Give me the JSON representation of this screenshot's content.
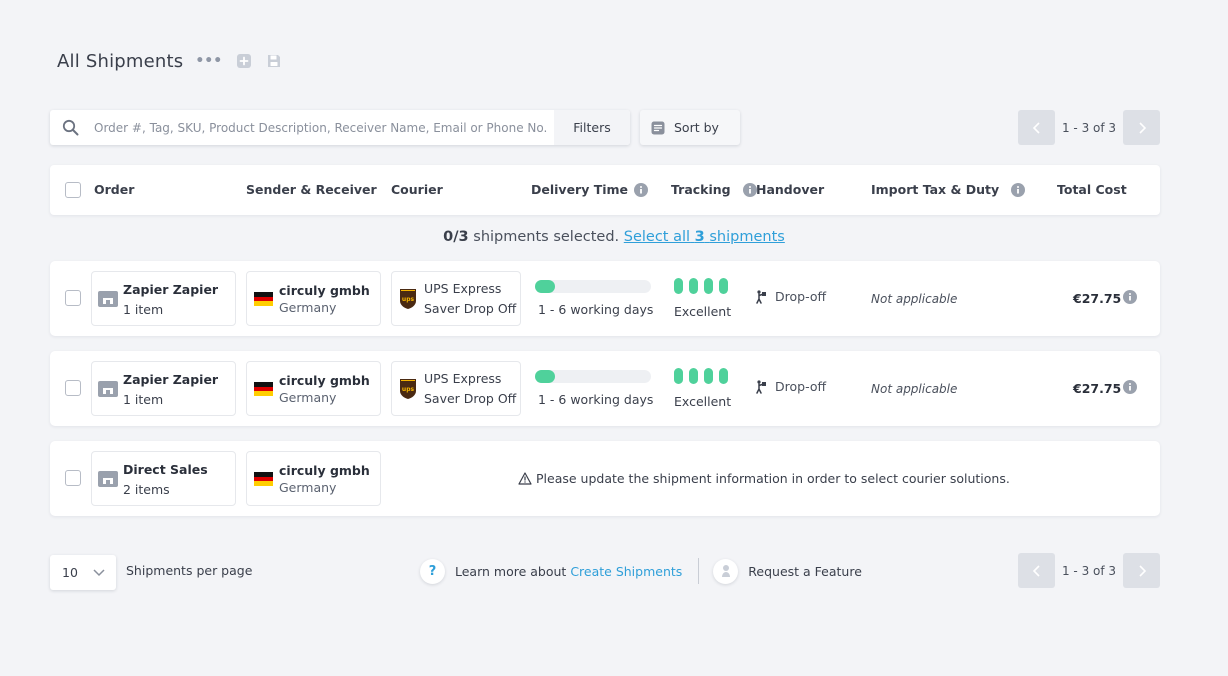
{
  "header": {
    "title": "All Shipments",
    "more_icon": "ellipsis-icon",
    "add_icon": "plus-square-icon",
    "save_icon": "floppy-disk-icon"
  },
  "toolbar": {
    "search_placeholder": "Order #, Tag, SKU, Product Description, Receiver Name, Email or Phone No.",
    "filters_label": "Filters",
    "sort_label": "Sort by",
    "pagination_text": "1 - 3 of 3"
  },
  "columns": [
    "Order",
    "Sender & Receiver",
    "Courier",
    "Delivery Time",
    "Tracking",
    "Handover",
    "Import Tax & Duty",
    "Total Cost"
  ],
  "selection": {
    "count": "0/3",
    "text": "shipments selected.",
    "link_prefix": "Select all",
    "link_count": "3",
    "link_suffix": "shipments"
  },
  "rows": [
    {
      "order_name": "Zapier Zapier",
      "order_items": "1 item",
      "sender_name": "circuly gmbh",
      "sender_country": "Germany",
      "courier_line1": "UPS Express",
      "courier_line2": "Saver Drop Off",
      "delivery_progress": 0.17,
      "delivery_days": "1 - 6 working days",
      "tracking_rating": "Excellent",
      "tracking_level": 4,
      "handover": "Drop-off",
      "import_tax": "Not applicable",
      "total_cost": "€27.75"
    },
    {
      "order_name": "Zapier Zapier",
      "order_items": "1 item",
      "sender_name": "circuly gmbh",
      "sender_country": "Germany",
      "courier_line1": "UPS Express",
      "courier_line2": "Saver Drop Off",
      "delivery_progress": 0.17,
      "delivery_days": "1 - 6 working days",
      "tracking_rating": "Excellent",
      "tracking_level": 4,
      "handover": "Drop-off",
      "import_tax": "Not applicable",
      "total_cost": "€27.75"
    },
    {
      "order_name": "Direct Sales",
      "order_items": "2 items",
      "sender_name": "circuly gmbh",
      "sender_country": "Germany",
      "warning": "Please update the shipment information in order to select courier solutions."
    }
  ],
  "footer": {
    "per_page_value": "10",
    "per_page_label": "Shipments per page",
    "help_icon_text": "?",
    "learn_more_text": "Learn more about",
    "learn_more_link": "Create Shipments",
    "feature_label": "Request a Feature",
    "pagination_text": "1 - 3 of 3"
  },
  "colors": {
    "accent_green": "#4fd19b",
    "link_blue": "#2f9fd9",
    "background": "#f3f4f7"
  }
}
